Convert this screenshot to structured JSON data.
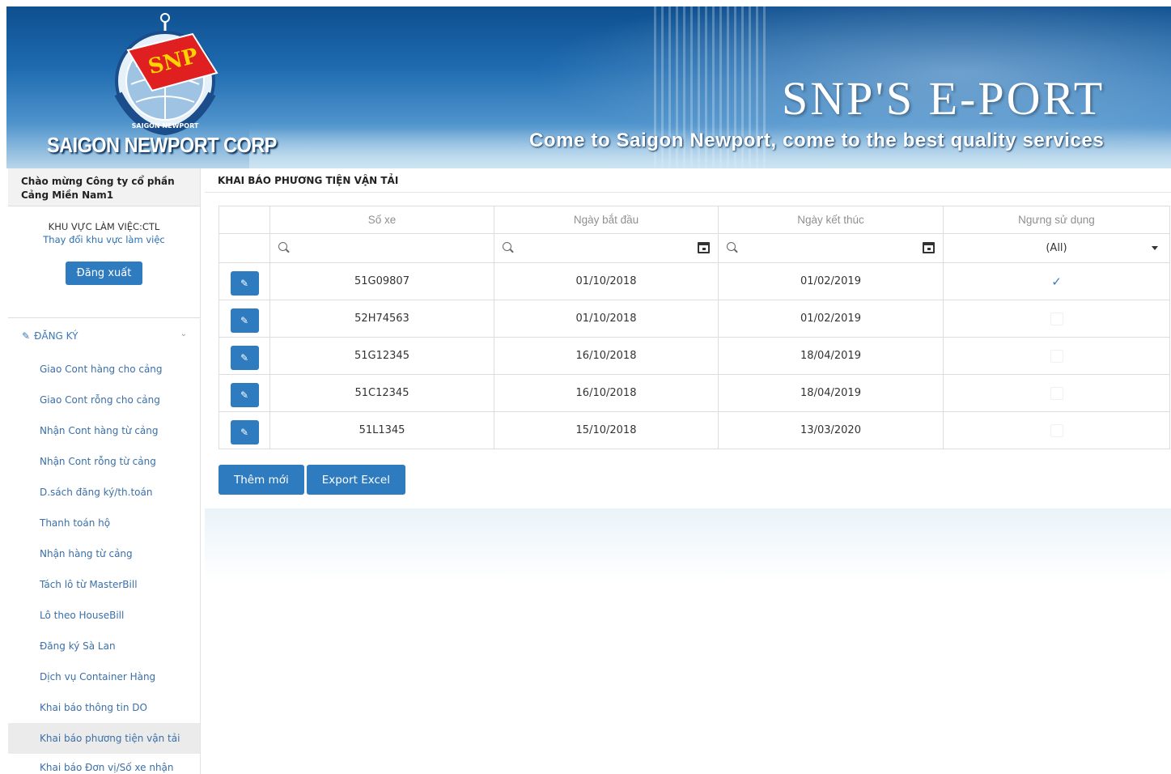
{
  "banner": {
    "logo_text": "SNP",
    "logo_ring_text": "SAIGON NEWPORT",
    "corp_name": "SAIGON NEWPORT CORP",
    "eport_title": "SNP'S E-PORT",
    "tagline": "Come to Saigon Newport, come to the best quality services"
  },
  "sidebar": {
    "welcome": "Chào mừng Công ty cổ phần Cảng Miền Nam1",
    "work_area_label": "KHU VỰC LÀM VIỆC:CTL",
    "change_area": "Thay đổi khu vực làm việc",
    "logout": "Đăng xuất",
    "register_header": "ĐĂNG KÝ",
    "items": [
      {
        "label": "Giao Cont hàng cho cảng"
      },
      {
        "label": "Giao Cont rỗng cho cảng"
      },
      {
        "label": "Nhận Cont hàng từ cảng"
      },
      {
        "label": "Nhận Cont rỗng từ cảng"
      },
      {
        "label": "D.sách đăng ký/th.toán"
      },
      {
        "label": "Thanh toán hộ"
      },
      {
        "label": "Nhận hàng từ cảng"
      },
      {
        "label": "Tách lô từ MasterBill"
      },
      {
        "label": "Lô theo HouseBill"
      },
      {
        "label": "Đăng ký Sà Lan"
      },
      {
        "label": "Dịch vụ Container Hàng"
      },
      {
        "label": "Khai báo thông tin DO"
      },
      {
        "label": "Khai báo phương tiện vận tải"
      },
      {
        "label": "Khai báo Đơn vị/Số xe nhận container"
      }
    ]
  },
  "main": {
    "title": "KHAI BÁO PHƯƠNG TIỆN VẬN TẢI",
    "columns": [
      "Số xe",
      "Ngày bắt đầu",
      "Ngày kết thúc",
      "Ngưng sử dụng"
    ],
    "filter_all": "(All)",
    "rows": [
      {
        "plate": "51G09807",
        "start": "01/10/2018",
        "end": "01/02/2019",
        "inactive": true
      },
      {
        "plate": "52H74563",
        "start": "01/10/2018",
        "end": "01/02/2019",
        "inactive": false
      },
      {
        "plate": "51G12345",
        "start": "16/10/2018",
        "end": "18/04/2019",
        "inactive": false
      },
      {
        "plate": "51C12345",
        "start": "16/10/2018",
        "end": "18/04/2019",
        "inactive": false
      },
      {
        "plate": "51L1345",
        "start": "15/10/2018",
        "end": "13/03/2020",
        "inactive": false
      }
    ],
    "add_new": "Thêm mới",
    "export": "Export Excel"
  },
  "colors": {
    "primary": "#2f7bbf",
    "link": "#3b6fa8",
    "banner_dark": "#0e4f8f"
  }
}
